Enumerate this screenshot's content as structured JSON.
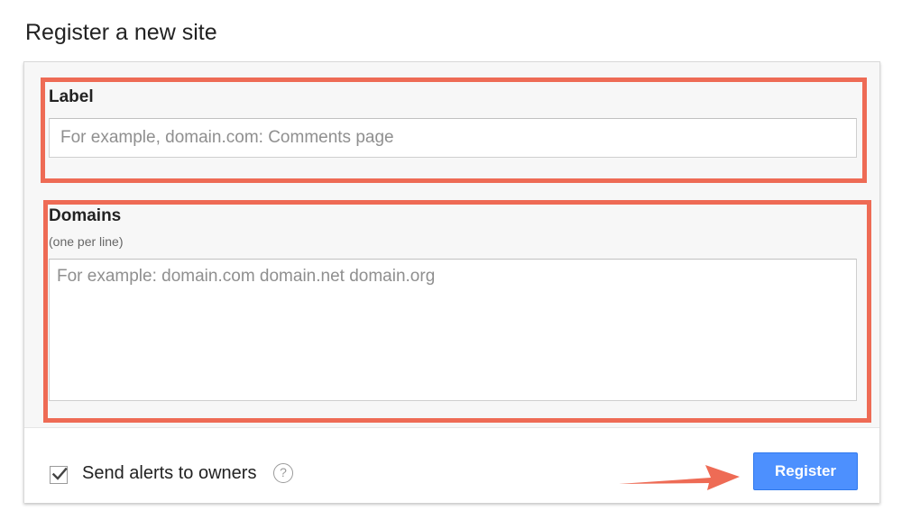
{
  "page": {
    "title": "Register a new site"
  },
  "form": {
    "label_field": {
      "label": "Label",
      "placeholder": "For example, domain.com: Comments page",
      "value": ""
    },
    "domains_field": {
      "label": "Domains",
      "hint": "(one per line)",
      "placeholder": "For example: domain.com domain.net domain.org",
      "value": ""
    },
    "alerts": {
      "label": "Send alerts to owners",
      "checked": true,
      "help_icon": "question-mark-icon",
      "help_glyph": "?"
    },
    "register_button": {
      "label": "Register"
    }
  },
  "annotations": {
    "highlight_color": "#ee6b55",
    "button_color": "#4d90fe"
  }
}
